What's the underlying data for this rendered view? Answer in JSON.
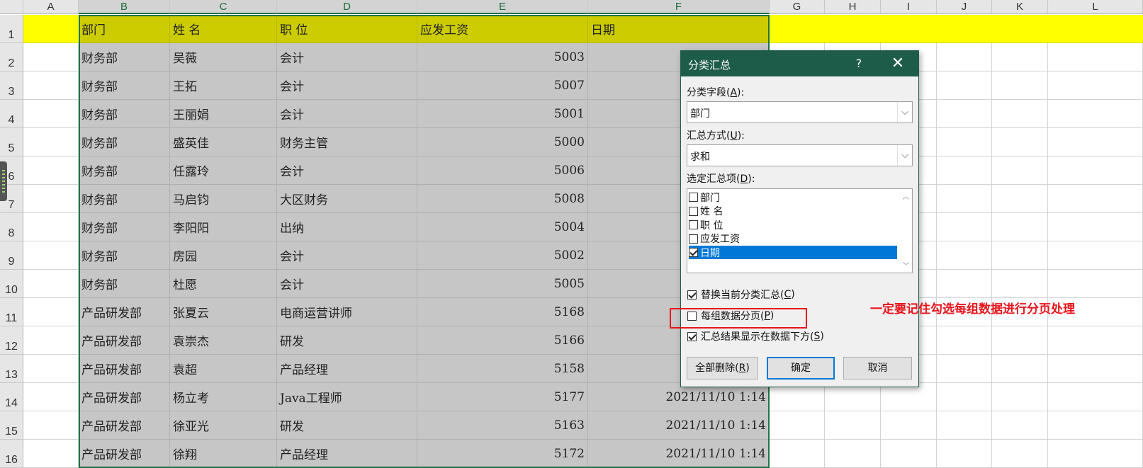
{
  "columns": [
    "A",
    "B",
    "C",
    "D",
    "E",
    "F",
    "G",
    "H",
    "I",
    "J",
    "K",
    "L"
  ],
  "rows": [
    "1",
    "2",
    "3",
    "4",
    "5",
    "6",
    "7",
    "8",
    "9",
    "10",
    "11",
    "12",
    "13",
    "14",
    "15",
    "16"
  ],
  "header_row": [
    "部门",
    "姓 名",
    "职 位",
    "应发工资",
    "日期"
  ],
  "data_rows": [
    [
      "财务部",
      "吴薇",
      "会计",
      "5003",
      "2"
    ],
    [
      "财务部",
      "王拓",
      "会计",
      "5007",
      "2"
    ],
    [
      "财务部",
      "王丽娟",
      "会计",
      "5001",
      "2"
    ],
    [
      "财务部",
      "盛英佳",
      "财务主管",
      "5000",
      "2"
    ],
    [
      "财务部",
      "任露玲",
      "会计",
      "5006",
      "2"
    ],
    [
      "财务部",
      "马启钧",
      "大区财务",
      "5008",
      "2"
    ],
    [
      "财务部",
      "李阳阳",
      "出纳",
      "5004",
      "2"
    ],
    [
      "财务部",
      "房园",
      "会计",
      "5002",
      "2"
    ],
    [
      "财务部",
      "杜愿",
      "会计",
      "5005",
      "2"
    ],
    [
      "产品研发部",
      "张夏云",
      "电商运营讲师",
      "5168",
      "2"
    ],
    [
      "产品研发部",
      "袁崇杰",
      "研发",
      "5166",
      "2"
    ],
    [
      "产品研发部",
      "袁超",
      "产品经理",
      "5158",
      "2"
    ],
    [
      "产品研发部",
      "杨立考",
      "Java工程师",
      "5177",
      "2021/11/10  1:14"
    ],
    [
      "产品研发部",
      "徐亚光",
      "研发",
      "5163",
      "2021/11/10  1:14"
    ],
    [
      "产品研发部",
      "徐翔",
      "产品经理",
      "5172",
      "2021/11/10  1:14"
    ]
  ],
  "dialog": {
    "title": "分类汇总",
    "help": "?",
    "close": "✕",
    "group_by": {
      "label": "分类字段(",
      "key": "A",
      "suffix": "):",
      "value": "部门"
    },
    "function": {
      "label": "汇总方式(",
      "key": "U",
      "suffix": "):",
      "value": "求和"
    },
    "add_to": {
      "label": "选定汇总项(",
      "key": "D",
      "suffix": "):"
    },
    "fields": [
      {
        "label": "部门",
        "checked": false
      },
      {
        "label": "姓 名",
        "checked": false
      },
      {
        "label": "职 位",
        "checked": false
      },
      {
        "label": "应发工资",
        "checked": false
      },
      {
        "label": "日期",
        "checked": true
      }
    ],
    "options": [
      {
        "label": "替换当前分类汇总(",
        "key": "C",
        "suffix": ")",
        "checked": true
      },
      {
        "label": "每组数据分页(",
        "key": "P",
        "suffix": ")",
        "checked": false
      },
      {
        "label": "汇总结果显示在数据下方(",
        "key": "S",
        "suffix": ")",
        "checked": true
      }
    ],
    "remove_all": {
      "label": "全部删除(",
      "key": "R",
      "suffix": ")"
    },
    "ok": "确定",
    "cancel": "取消"
  },
  "annotation": "一定要记住勾选每组数据进行分页处理",
  "colors": {
    "header_fill": "#cccc00",
    "row1_fill": "#ffff00",
    "selection": "#c6c6c6",
    "dialog_title": "#1e5c4a",
    "annotation": "#e8141c"
  }
}
